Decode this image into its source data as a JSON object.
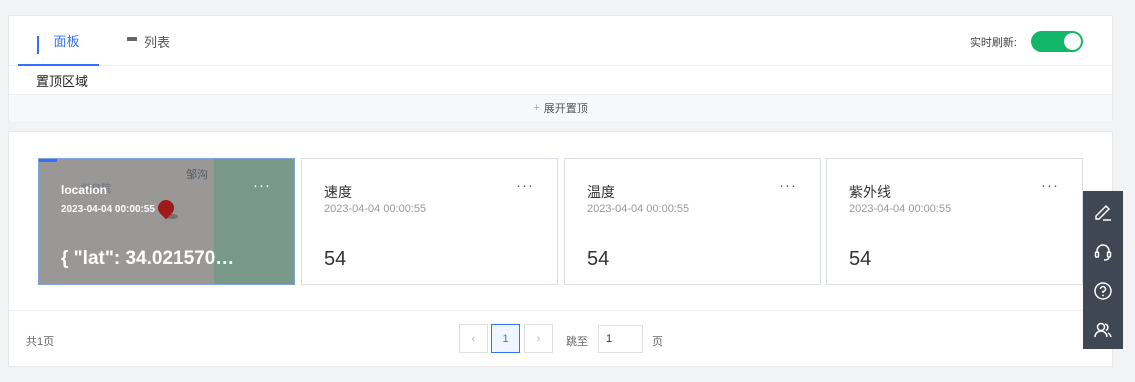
{
  "header": {
    "tabs": [
      {
        "label": "面板",
        "icon": "grid-icon",
        "active": true
      },
      {
        "label": "列表",
        "icon": "list-icon",
        "active": false
      }
    ],
    "refresh_label": "实时刷新:",
    "refresh_on": true,
    "accent_color": "#3370ff",
    "toggle_color": "#12b76a"
  },
  "pinned": {
    "title": "置顶区域",
    "expand_label": "展开置顶"
  },
  "cards": [
    {
      "title": "location",
      "time": "2023-04-04 00:00:55",
      "value": "{ \"lat\": 34.021570…",
      "map_labels": [
        "邹沟",
        "恒皂院"
      ]
    },
    {
      "title": "速度",
      "time": "2023-04-04 00:00:55",
      "value": "54"
    },
    {
      "title": "温度",
      "time": "2023-04-04 00:00:55",
      "value": "54"
    },
    {
      "title": "紫外线",
      "time": "2023-04-04 00:00:55",
      "value": "54"
    }
  ],
  "card_more": "···",
  "pagination": {
    "total": "共1页",
    "prev": "‹",
    "current": "1",
    "next": "›",
    "jump_label": "跳至",
    "jump_value": "1",
    "page_suffix": "页"
  },
  "side_tools": [
    "edit-icon",
    "headset-icon",
    "help-icon",
    "users-icon"
  ]
}
